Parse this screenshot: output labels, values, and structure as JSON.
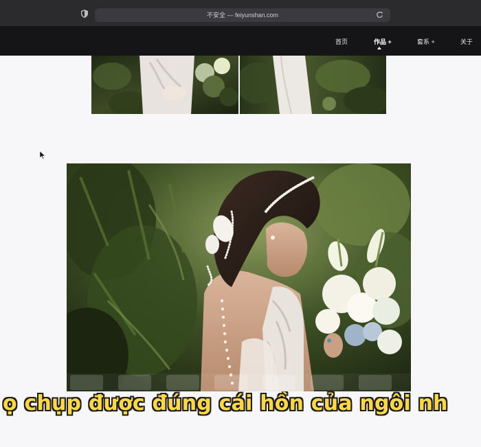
{
  "browser": {
    "address_text": "不安全 — feiyunshan.com"
  },
  "nav": {
    "items": [
      {
        "label": "首页"
      },
      {
        "label": "作品 +"
      },
      {
        "label": "套系 +"
      },
      {
        "label": "关于"
      }
    ],
    "active_index": 1
  },
  "subtitle": {
    "text": "ọ chụp được đúng cái hồn của ngôi nh"
  },
  "colors": {
    "chrome_bg": "#2b2b2e",
    "nav_bg": "#151517",
    "page_bg": "#f7f6f8",
    "subtitle_fill": "#ffd84a",
    "subtitle_stroke": "#1c1c1c"
  }
}
